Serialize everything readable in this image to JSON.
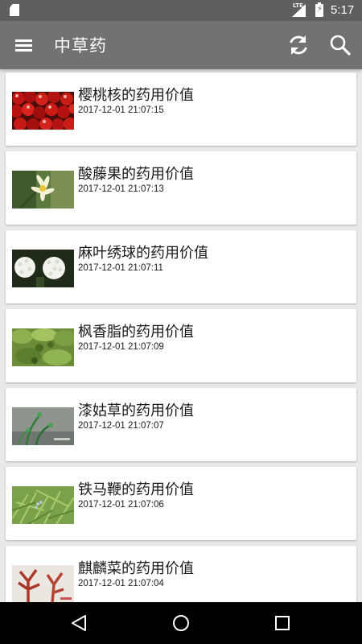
{
  "status_bar": {
    "network_label": "LTE",
    "time": "5:17"
  },
  "app_bar": {
    "title": "中草药",
    "icons": [
      "menu-icon",
      "refresh-icon",
      "search-icon"
    ]
  },
  "list": {
    "items": [
      {
        "title": "樱桃核的药用价值",
        "timestamp": "2017-12-01 21:07:15",
        "thumbnail": "cherries"
      },
      {
        "title": "酸藤果的药用价值",
        "timestamp": "2017-12-01 21:07:13",
        "thumbnail": "white-yellow-flower"
      },
      {
        "title": "麻叶绣球的药用价值",
        "timestamp": "2017-12-01 21:07:11",
        "thumbnail": "white-flower-clusters"
      },
      {
        "title": "枫香脂的药用价值",
        "timestamp": "2017-12-01 21:07:09",
        "thumbnail": "green-leaves"
      },
      {
        "title": "漆姑草的药用价值",
        "timestamp": "2017-12-01 21:07:07",
        "thumbnail": "green-sprouts"
      },
      {
        "title": "铁马鞭的药用价值",
        "timestamp": "2017-12-01 21:07:06",
        "thumbnail": "green-grass"
      },
      {
        "title": "麒麟菜的药用价值",
        "timestamp": "2017-12-01 21:07:04",
        "thumbnail": "red-seaweed"
      }
    ]
  },
  "nav_bar": {
    "icons": [
      "back-icon",
      "home-icon",
      "recent-apps-icon"
    ]
  },
  "colors": {
    "status_bar": "#5f5f5d",
    "app_bar": "#727270",
    "background": "#e9e9e9",
    "card": "#ffffff",
    "nav_bar": "#000000"
  }
}
